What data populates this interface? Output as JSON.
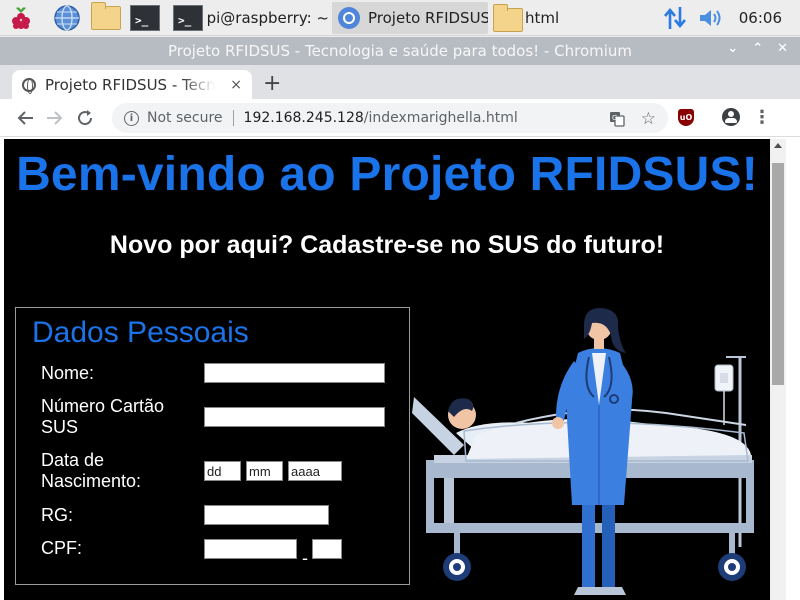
{
  "taskbar": {
    "terminal_task": "pi@raspberry: ~",
    "browser_task": "Projeto RFIDSUS",
    "files_task": "html",
    "clock": "06:06"
  },
  "window": {
    "title": "Projeto RFIDSUS - Tecnologia e saúde para todos! - Chromium"
  },
  "tab": {
    "title": "Projeto RFIDSUS - Tecnologia e saúde para todos!",
    "close": "×",
    "new_tab": "+"
  },
  "address_bar": {
    "security_label": "Not secure",
    "host": "192.168.245.128",
    "path": "/indexmarighella.html"
  },
  "page": {
    "heading": "Bem-vindo ao Projeto RFIDSUS!",
    "subheading": "Novo por aqui? Cadastre-se no SUS do futuro!",
    "form": {
      "legend": "Dados Pessoais",
      "name_label": "Nome:",
      "sus_label_line1": "Número Cartão",
      "sus_label_line2": "SUS",
      "birth_label_line1": "Data de",
      "birth_label_line2": "Nascimento:",
      "day_placeholder": "dd",
      "month_placeholder": "mm",
      "year_placeholder": "aaaa",
      "rg_label": "RG:",
      "cpf_label": "CPF:",
      "cpf_separator": "-"
    }
  },
  "colors": {
    "accent_blue": "#1a73e8",
    "page_background": "#000000",
    "nurse_blue": "#2f6fcf",
    "bed_frame": "#a8b8cf"
  }
}
